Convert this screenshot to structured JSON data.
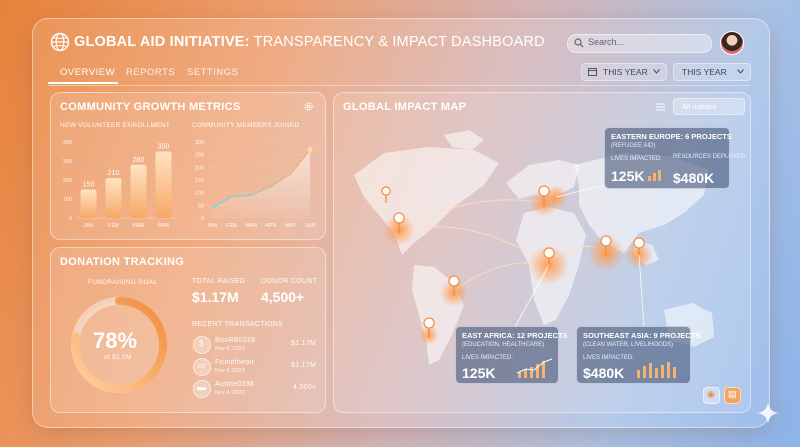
{
  "header": {
    "title_bold": "GLOBAL AID INITIATIVE:",
    "title_rest": " TRANSPARENCY & IMPACT DASHBOARD",
    "search_placeholder": "Search..."
  },
  "tabs": [
    {
      "label": "OVERVIEW",
      "active": true
    },
    {
      "label": "REPORTS",
      "active": false
    },
    {
      "label": "SETTINGS",
      "active": false
    }
  ],
  "filters": {
    "date_range_1": "THIS YEAR",
    "date_range_2": "THIS YEAR"
  },
  "community": {
    "title": "COMMUNITY GROWTH METRICS",
    "volunteer_label": "NEW VOLUNTEER ENROLLMENT",
    "members_label": "COMMUNITY MEMBERS JOINED"
  },
  "chart_data": [
    {
      "type": "bar",
      "title": "NEW VOLUNTEER ENROLLMENT",
      "categories": [
        "JAN",
        "FEB",
        "MAR",
        "APR"
      ],
      "values": [
        150,
        210,
        280,
        350
      ],
      "yticks": [
        "0",
        "100",
        "200",
        "300",
        "400"
      ],
      "ylim": [
        0,
        400
      ]
    },
    {
      "type": "area",
      "title": "COMMUNITY MEMBERS JOINED",
      "categories": [
        "JAN",
        "FEB",
        "MAR",
        "APR",
        "MAY",
        "JUN"
      ],
      "values": [
        40,
        85,
        90,
        125,
        175,
        270
      ],
      "yticks": [
        "0",
        "50",
        "100",
        "150",
        "200",
        "250",
        "300"
      ],
      "ylim": [
        0,
        300
      ]
    }
  ],
  "donations": {
    "title": "DONATION TRACKING",
    "goal_label": "FUNDRAISING GOAL",
    "percent": "78%",
    "percent_value": 0.78,
    "goal_text": "of $1.5M",
    "total_label": "TOTAL RAISED",
    "total_value": "$1.17M",
    "donor_label": "DONOR COUNT",
    "donor_value": "4,500+",
    "recent_label": "RECENT TRANSACTIONS",
    "transactions": [
      {
        "name": "BooRB0328",
        "date": "Nov 4, 2023",
        "amount": "$1.17M"
      },
      {
        "name": "Frunetheoir",
        "date": "Nov 4, 2023",
        "amount": "$1.17M"
      },
      {
        "name": "Auttrie0338",
        "date": "Nov 4, 2023",
        "amount": "4,500+"
      }
    ]
  },
  "map": {
    "title": "GLOBAL IMPACT MAP",
    "filter": "All nations",
    "callouts": [
      {
        "region": "EASTERN EUROPE: 6 PROJECTS",
        "sub": "(REFUGEE AID)",
        "lives_label": "LIVES IMPACTED:",
        "lives": "125K",
        "res_label": "RESOURCES DEPLOYED",
        "res": "$480K"
      },
      {
        "region": "EAST AFRICA: 12 PROJECTS",
        "sub": "(EDUCATION, HEALTHCARE)",
        "lives_label": "LIVES IMPACTED:",
        "lives": "125K"
      },
      {
        "region": "SOUTHEAST ASIA: 9 PROJECTS",
        "sub": "(CLEAN WATER, LIVELIHOODS)",
        "lives_label": "LIVES IMPACTED:",
        "lives": "$480K"
      }
    ]
  },
  "colors": {
    "accent": "#f28a3c",
    "accent_light": "#ffc08a",
    "line": "#7fd0e8"
  }
}
